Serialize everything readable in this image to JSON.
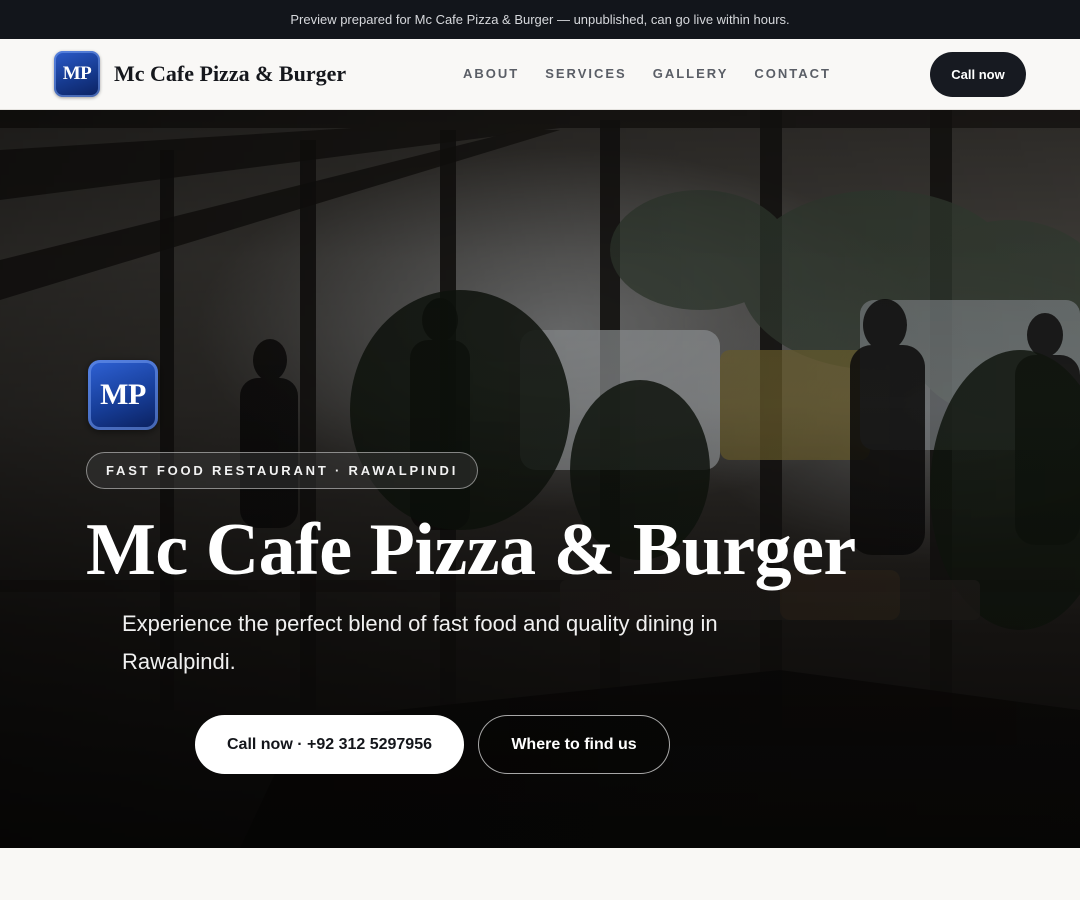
{
  "banner": {
    "text": "Preview prepared for Mc Cafe Pizza & Burger — unpublished, can go live within hours."
  },
  "header": {
    "logo_text": "MP",
    "brand_name": "Mc Cafe Pizza & Burger",
    "nav": [
      {
        "label": "ABOUT"
      },
      {
        "label": "SERVICES"
      },
      {
        "label": "GALLERY"
      },
      {
        "label": "CONTACT"
      }
    ],
    "cta_label": "Call now"
  },
  "hero": {
    "logo_text": "MP",
    "tagline": "FAST FOOD RESTAURANT · RAWALPINDI",
    "title": "Mc Cafe Pizza & Burger",
    "subtitle": "Experience the perfect blend of fast food and quality dining in Rawalpindi.",
    "primary_button": "Call now · +92 312 5297956",
    "secondary_button": "Where to find us",
    "background_icon": "restaurant-interior-photo"
  },
  "colors": {
    "banner_bg": "#12151b",
    "cta_bg": "#171a21",
    "logo_blue": "#173e99",
    "page_bg": "#f8f7f4"
  }
}
